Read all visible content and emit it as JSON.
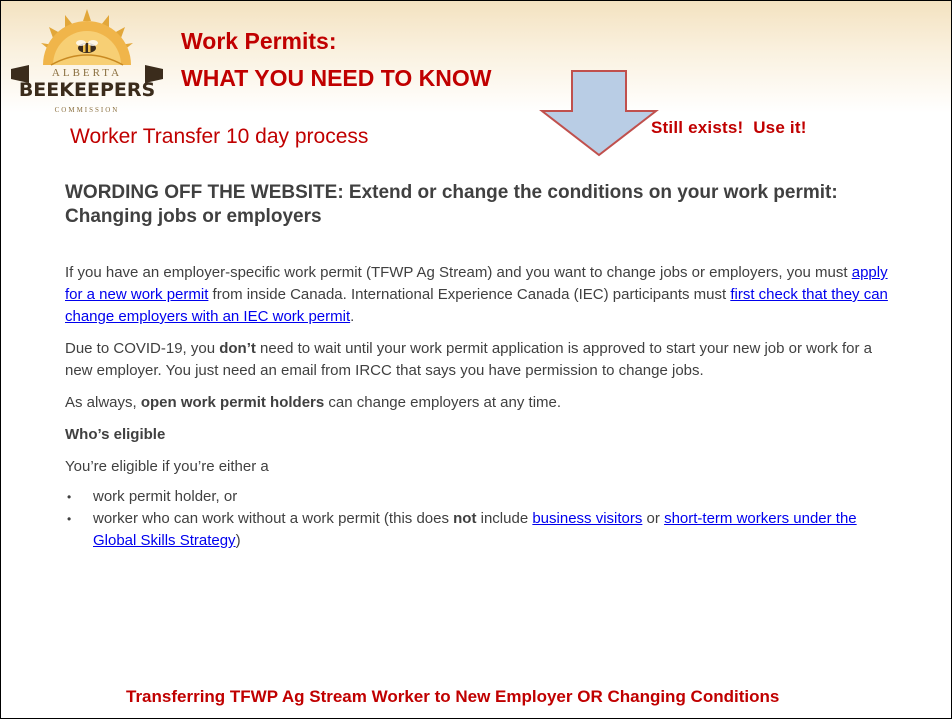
{
  "header": {
    "logo": {
      "alberta": "ALBERTA",
      "beekeepers": "BEEKEEPERS",
      "commission": "COMMISSION",
      "icon": "bee-sun-logo-icon"
    },
    "title_line_1": "Work Permits:",
    "title_line_2": "WHAT YOU NEED TO KNOW",
    "subtitle": "Worker Transfer 10 day process",
    "callout": "Still exists!  Use it!",
    "arrow_icon": "down-arrow-icon"
  },
  "heading": "WORDING OFF THE WEBSITE: Extend or change the conditions on your work permit: Changing jobs or employers",
  "para1": {
    "t1": "If you have an employer-specific work permit (TFWP Ag Stream) and you want to change jobs or employers, you must ",
    "link1": "apply for a new work permit",
    "t2": " from inside Canada. International Experience Canada (IEC) participants must ",
    "link2": "first check that they can change employers with an IEC work permit",
    "t3": "."
  },
  "para2": {
    "t1": "Due to COVID-19, you ",
    "bold": "don’t",
    "t2": " need to wait until your work permit application is approved to start your new job or work for a new employer. You just need an email from IRCC that says you have permission to change jobs."
  },
  "para3": {
    "t1": "As always, ",
    "bold": "open work permit holders",
    "t2": " can change employers at any time."
  },
  "eligible_heading": "Who’s eligible",
  "eligible_intro": "You’re eligible if you’re either a",
  "bullets": {
    "b1": "work permit holder, or",
    "b2": {
      "t1": "worker who can work without a work permit (this does ",
      "bold": "not",
      "t2": " include ",
      "link1": "business visitors",
      "t3": " or ",
      "link2": "short-term workers under the Global Skills Strategy",
      "t4": ")"
    }
  },
  "footer": "Transferring TFWP Ag Stream Worker to New Employer OR Changing Conditions",
  "colors": {
    "title_red": "#c00000",
    "body_text": "#404040",
    "link_blue": "#0000ee",
    "arrow_fill": "#b9cde5",
    "arrow_stroke": "#c0504d"
  }
}
